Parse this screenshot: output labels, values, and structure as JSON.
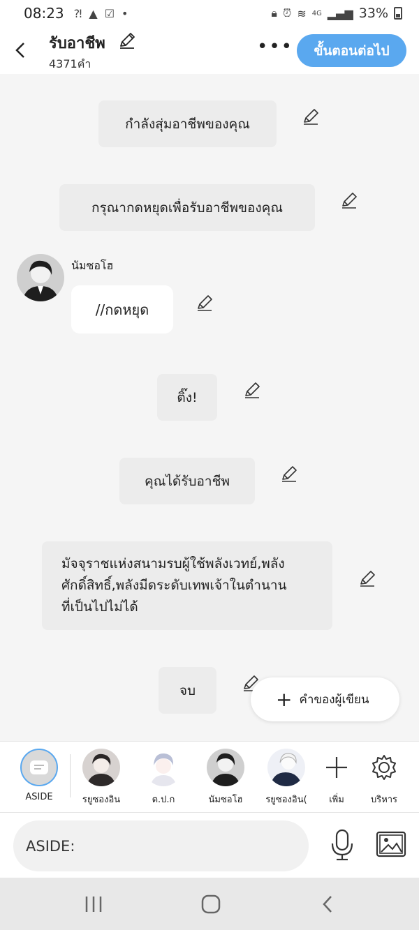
{
  "status_bar": {
    "time": "08:23",
    "battery_percent": "33%",
    "network": "4G"
  },
  "header": {
    "title": "รับอาชีพ",
    "word_count": "4371คำ",
    "next_button": "ขั้นตอนต่อไป"
  },
  "messages": [
    {
      "type": "narration",
      "text": "กำลังสุ่มอาชีพของคุณ"
    },
    {
      "type": "narration",
      "text": "กรุณากดหยุดเพื่อรับอาชีพของคุณ"
    },
    {
      "type": "character",
      "speaker": "นัมซอโฮ",
      "text": "//กดหยุด"
    },
    {
      "type": "narration",
      "text": "ติ๊ง!"
    },
    {
      "type": "narration",
      "text": "คุณได้รับอาชีพ"
    },
    {
      "type": "narration",
      "lines": [
        "มัจจุราชแห่งสนามรบผู้ใช้พลังเวทย์,พลัง",
        "ศักดิ์สิทธิ์,พลังมีดระดับเทพเจ้าในตำนาน",
        "ที่เป็นไปไม่ได้"
      ]
    },
    {
      "type": "narration",
      "text": "จบ"
    }
  ],
  "floating_button": {
    "label": "คำของผู้เขียน"
  },
  "characters": [
    {
      "name": "ASIDE",
      "selected": true
    },
    {
      "name": "รยูซองอิน"
    },
    {
      "name": "ต.ป.ก"
    },
    {
      "name": "นัมซอโฮ"
    },
    {
      "name": "รยูซองอิน("
    }
  ],
  "actions": {
    "add_label": "เพิ่ม",
    "manage_label": "บริหาร"
  },
  "input": {
    "placeholder": "ASIDE:"
  },
  "colors": {
    "accent": "#5aa8ef",
    "bubble": "#ececec",
    "background": "#f5f5f5"
  }
}
